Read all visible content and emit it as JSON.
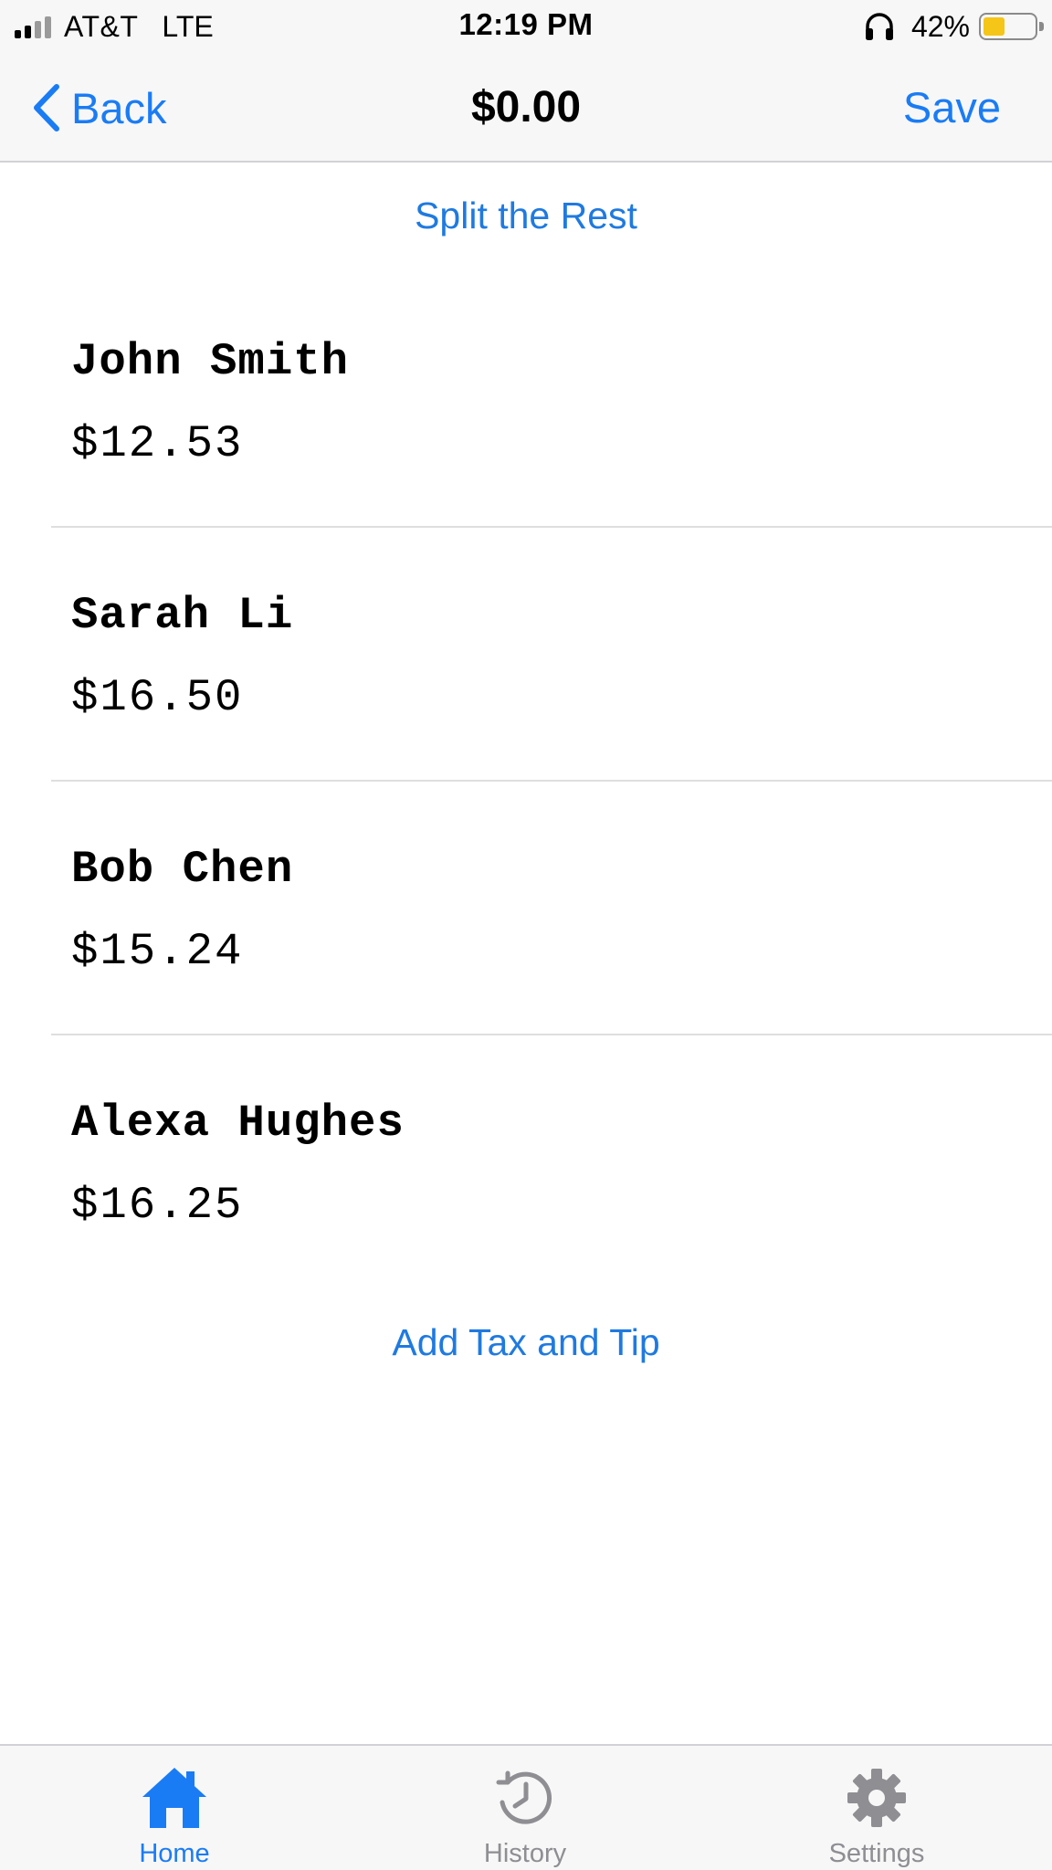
{
  "status_bar": {
    "carrier": "AT&T",
    "network": "LTE",
    "time": "12:19 PM",
    "battery_percent": "42%",
    "battery_level": 0.42,
    "icons": [
      "signal-icon",
      "headphones-icon",
      "battery-icon"
    ]
  },
  "nav": {
    "back_label": "Back",
    "title": "$0.00",
    "save_label": "Save"
  },
  "actions": {
    "split_rest": "Split the Rest",
    "add_tax_tip": "Add Tax and Tip"
  },
  "people": [
    {
      "name": "John Smith",
      "amount": "$12.53"
    },
    {
      "name": "Sarah Li",
      "amount": "$16.50"
    },
    {
      "name": "Bob Chen",
      "amount": "$15.24"
    },
    {
      "name": "Alexa Hughes",
      "amount": "$16.25"
    }
  ],
  "tabs": [
    {
      "label": "Home",
      "icon": "home-icon",
      "selected": true
    },
    {
      "label": "History",
      "icon": "history-icon",
      "selected": false
    },
    {
      "label": "Settings",
      "icon": "gear-icon",
      "selected": false
    }
  ],
  "colors": {
    "accent": "#1a7cf5",
    "tab_inactive": "#8e8e93",
    "battery": "#f5c518",
    "bar_background": "#f7f7f7"
  }
}
